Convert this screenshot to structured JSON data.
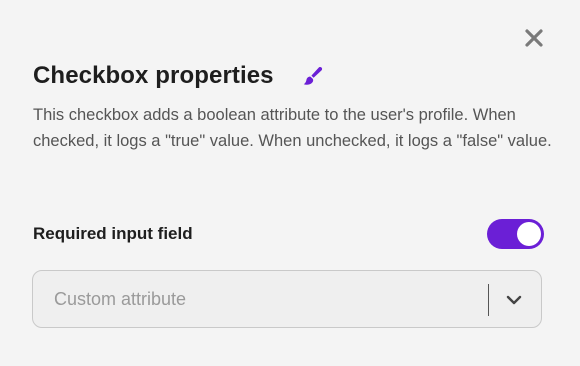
{
  "dialog": {
    "title": "Checkbox properties",
    "description": "This checkbox adds a boolean attribute to the user's profile. When checked, it logs a \"true\" value. When unchecked, it logs a \"false\" value.",
    "close_icon": "close-icon",
    "edit_icon": "paintbrush-icon"
  },
  "required": {
    "label": "Required input field",
    "enabled": true
  },
  "attribute_select": {
    "placeholder": "Custom attribute",
    "icon": "chevron-down-icon"
  },
  "colors": {
    "accent": "#6b1fd6",
    "background": "#f4f4f4",
    "text": "#1e1e1e",
    "muted_text": "#555555"
  }
}
